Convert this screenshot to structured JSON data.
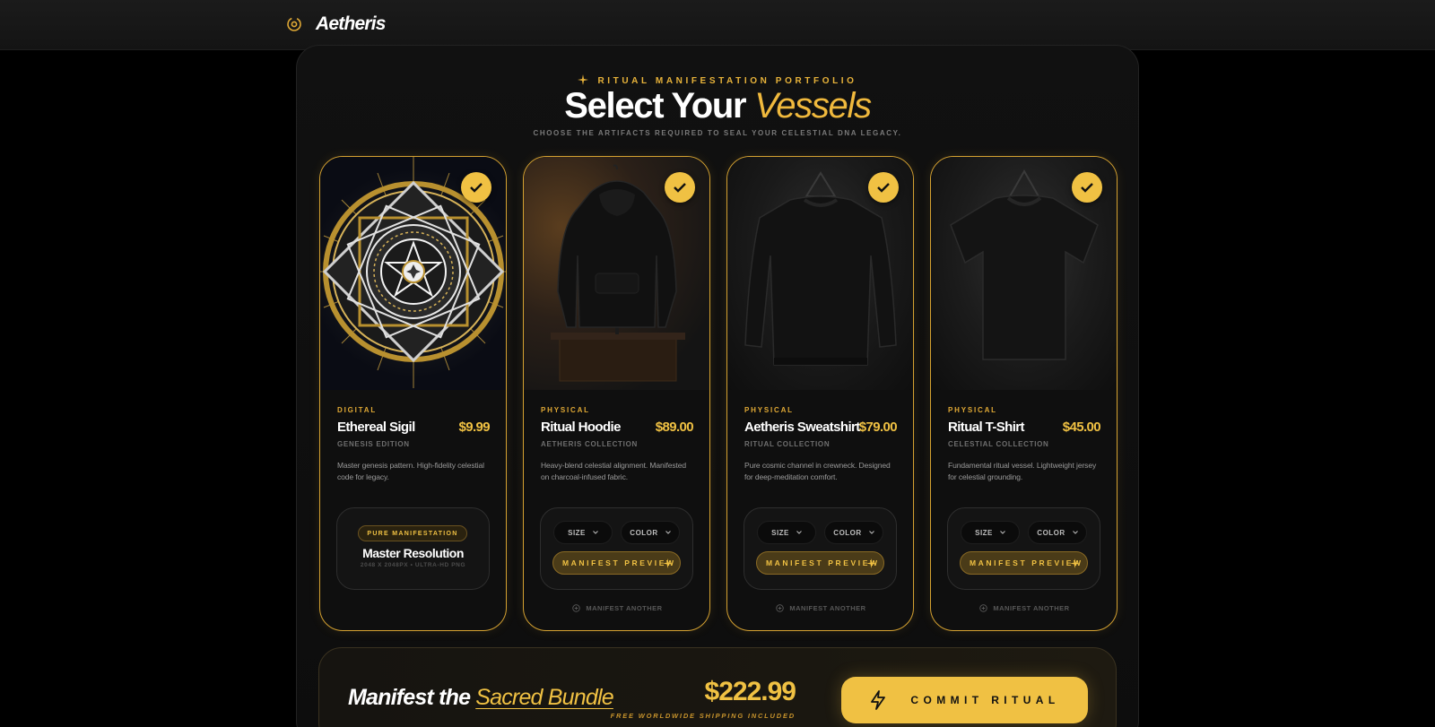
{
  "brand": {
    "name": "Aetheris",
    "icon": "orbit-logo-icon"
  },
  "header": {
    "eyebrow": "RITUAL MANIFESTATION PORTFOLIO",
    "title_main": "Select Your",
    "title_accent": "Vessels",
    "subtitle": "CHOOSE THE ARTIFACTS REQUIRED TO SEAL YOUR CELESTIAL DNA LEGACY."
  },
  "colors": {
    "accent": "#f0c143",
    "accent_dark": "#d4a131",
    "background": "#000000",
    "panel": "#111111"
  },
  "cards": [
    {
      "category": "DIGITAL",
      "name": "Ethereal Sigil",
      "price": "$9.99",
      "collection": "GENESIS EDITION",
      "description": "Master genesis pattern. High-fidelity celestial code for legacy.",
      "selected": true,
      "badge": "PURE MANIFESTATION",
      "resolution_title": "Master Resolution",
      "resolution_sub": "2048 X 2048PX • ULTRA-HD PNG"
    },
    {
      "category": "PHYSICAL",
      "name": "Ritual Hoodie",
      "price": "$89.00",
      "collection": "AETHERIS COLLECTION",
      "description": "Heavy-blend celestial alignment. Manifested on charcoal-infused fabric.",
      "selected": true,
      "size_label": "SIZE",
      "color_label": "COLOR",
      "preview_label": "MANIFEST PREVIEW",
      "another_label": "MANIFEST ANOTHER"
    },
    {
      "category": "PHYSICAL",
      "name": "Aetheris Sweatshirt",
      "price": "$79.00",
      "collection": "RITUAL COLLECTION",
      "description": "Pure cosmic channel in crewneck. Designed for deep-meditation comfort.",
      "selected": true,
      "size_label": "SIZE",
      "color_label": "COLOR",
      "preview_label": "MANIFEST PREVIEW",
      "another_label": "MANIFEST ANOTHER"
    },
    {
      "category": "PHYSICAL",
      "name": "Ritual T-Shirt",
      "price": "$45.00",
      "collection": "CELESTIAL COLLECTION",
      "description": "Fundamental ritual vessel. Lightweight jersey for celestial grounding.",
      "selected": true,
      "size_label": "SIZE",
      "color_label": "COLOR",
      "preview_label": "MANIFEST PREVIEW",
      "another_label": "MANIFEST ANOTHER"
    }
  ],
  "bundle": {
    "title_main": "Manifest the",
    "title_accent": "Sacred Bundle",
    "total": "$222.99",
    "shipping": "FREE WORLDWIDE SHIPPING INCLUDED",
    "cta": "COMMIT RITUAL"
  }
}
